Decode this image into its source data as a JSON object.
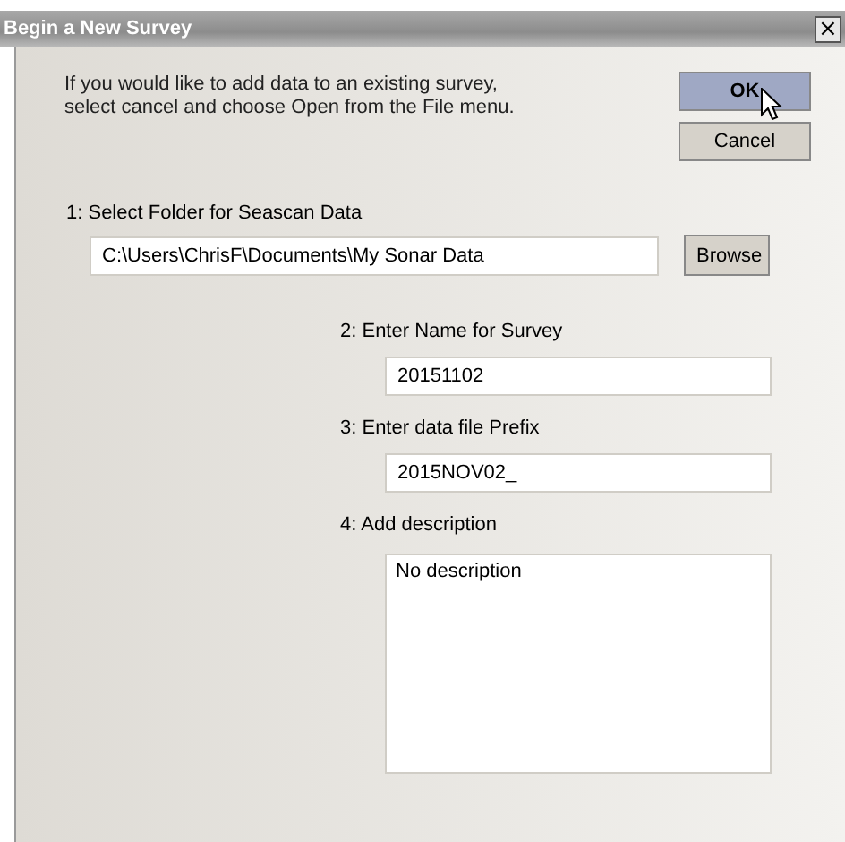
{
  "window": {
    "title": "Begin a New Survey",
    "close": "×"
  },
  "intro": "If you would like to add data to an existing survey,\nselect cancel and choose Open from the File menu.",
  "buttons": [
    {
      "label": "OK",
      "default": true
    },
    {
      "label": "Cancel",
      "default": false
    }
  ],
  "folder": {
    "label": "1: Select Folder for Seascan Data",
    "value": "C:\\Users\\ChrisF\\Documents\\My Sonar Data",
    "button": "Browse"
  },
  "fields": [
    {
      "label": "2: Enter Name for Survey",
      "value": "20151102",
      "kind": "line"
    },
    {
      "label": "3: Enter data file Prefix",
      "value": "2015NOV02_",
      "kind": "line"
    },
    {
      "label": "4: Add description",
      "value": "No description",
      "kind": "area"
    }
  ]
}
